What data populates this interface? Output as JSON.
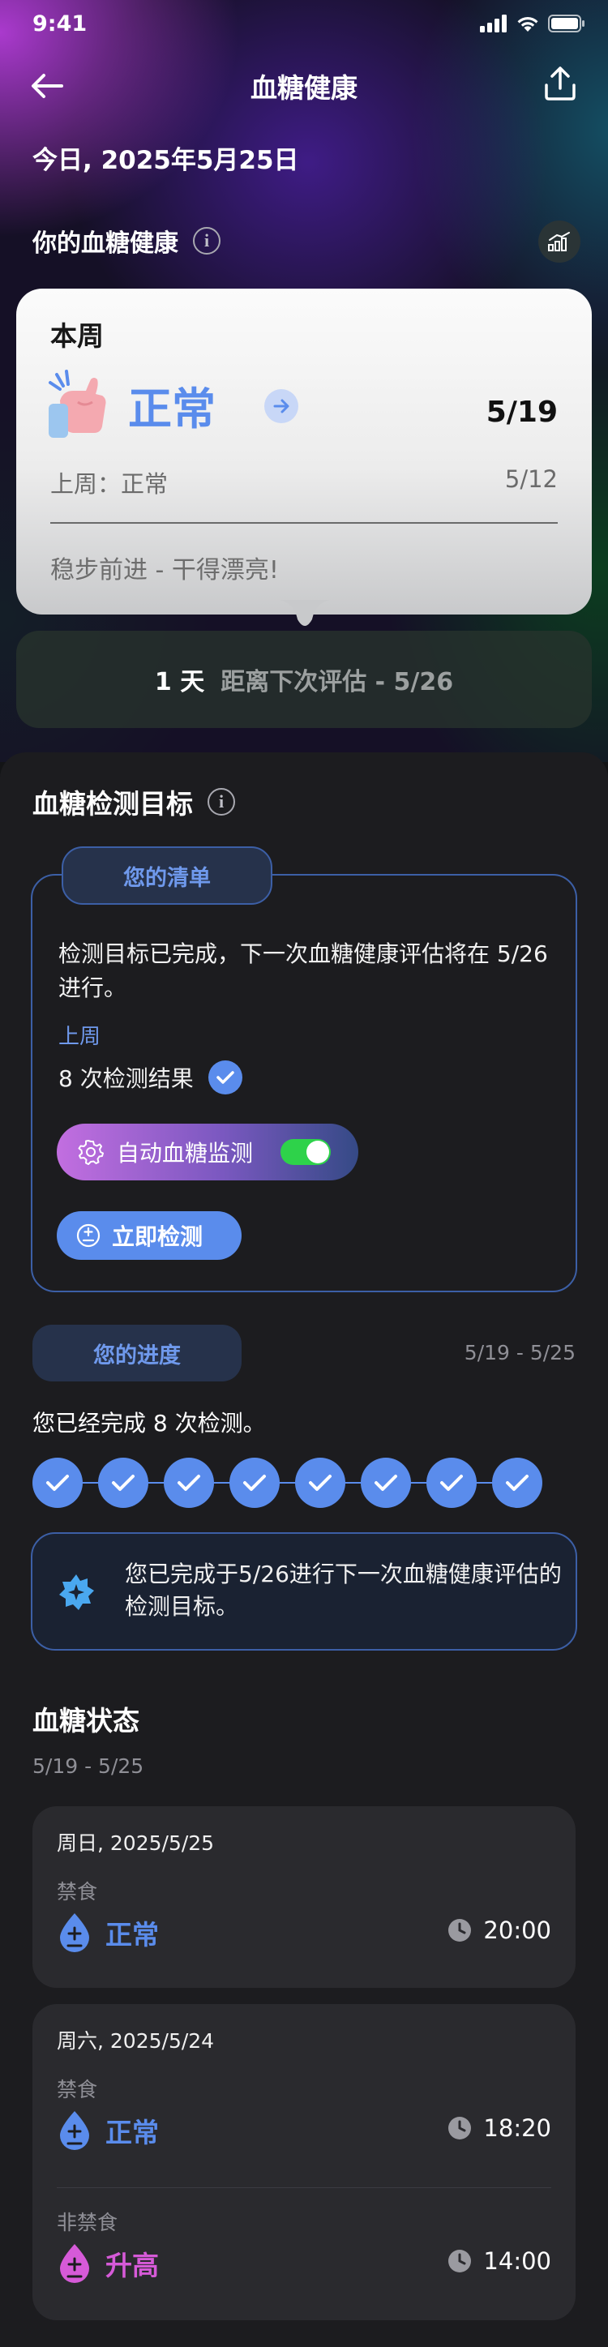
{
  "status_bar": {
    "time": "9:41"
  },
  "nav": {
    "title": "血糖健康"
  },
  "header": {
    "date": "今日, 2025年5月25日",
    "section_title": "你的血糖健康"
  },
  "week_card": {
    "label": "本周",
    "status": "正常",
    "date": "5/19",
    "last_week_label": "上周：正常",
    "last_week_date": "5/12",
    "note": "稳步前进 - 干得漂亮!"
  },
  "next_assessment": {
    "days": "1 天",
    "text": "距离下次评估 - 5/26"
  },
  "goals": {
    "title": "血糖检测目标",
    "tab": "您的清单",
    "description": "检测目标已完成，下一次血糖健康评估将在 5/26 进行。",
    "last_week": "上周",
    "count": "8 次检测结果",
    "auto_monitor": "自动血糖监测",
    "auto_monitor_on": true,
    "test_now": "立即检测"
  },
  "progress": {
    "tab": "您的进度",
    "range": "5/19 - 5/25",
    "text": "您已经完成 8 次检测。",
    "completed": 8,
    "done_message": "您已完成于5/26进行下一次血糖健康评估的检测目标。"
  },
  "blood_sugar": {
    "title": "血糖状态",
    "range": "5/19 - 5/25",
    "days": [
      {
        "date": "周日, 2025/5/25",
        "readings": [
          {
            "type": "禁食",
            "status": "正常",
            "time": "20:00",
            "color": "#5a8cec"
          }
        ]
      },
      {
        "date": "周六, 2025/5/24",
        "readings": [
          {
            "type": "禁食",
            "status": "正常",
            "time": "18:20",
            "color": "#5a8cec"
          },
          {
            "type": "非禁食",
            "status": "升高",
            "time": "14:00",
            "color": "#d65ad8"
          }
        ]
      }
    ]
  },
  "colors": {
    "accent": "#5a8cec",
    "elevated": "#d65ad8",
    "toggle_on": "#2ed24a"
  }
}
